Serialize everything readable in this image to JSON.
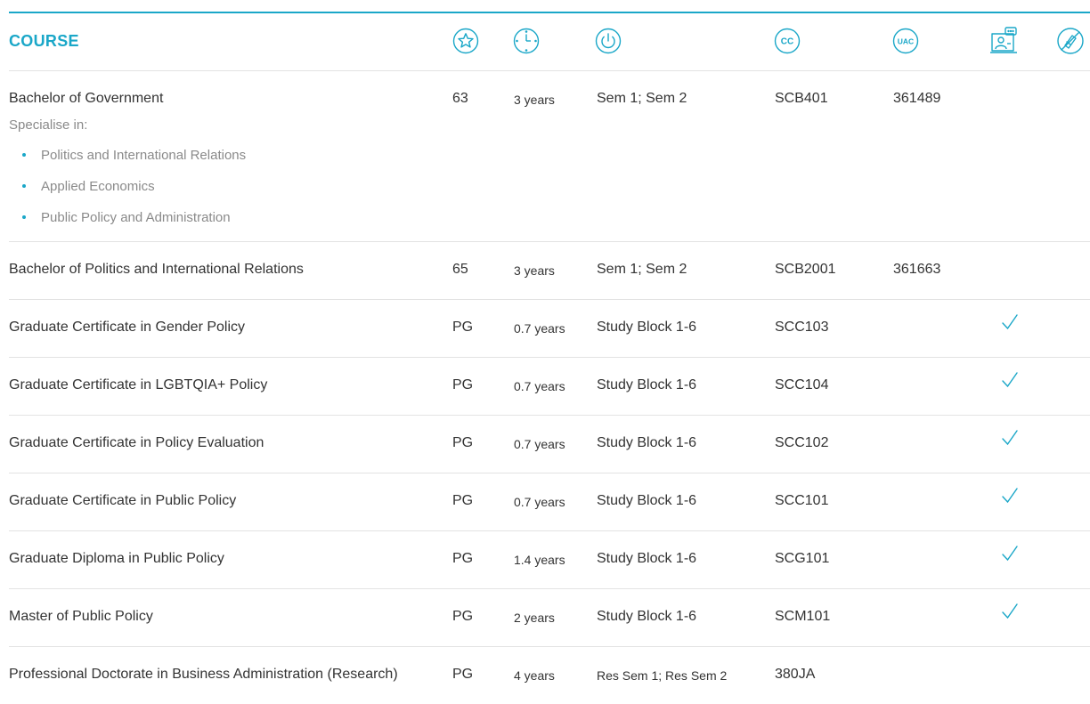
{
  "header": {
    "course_label": "COURSE",
    "icons": [
      "star-icon",
      "clock-icon",
      "power-icon",
      "cc-icon",
      "uac-icon",
      "online-icon",
      "no-campus-icon"
    ],
    "cc_text": "CC",
    "uac_text": "UAC"
  },
  "colors": {
    "accent": "#1aa7c8",
    "text": "#333333",
    "muted": "#8a8a8a",
    "divider": "#e3e3e3"
  },
  "rows": [
    {
      "title": "Bachelor of Government",
      "atar": "63",
      "duration": "3 years",
      "entry": "Sem 1; Sem 2",
      "cc": "SCB401",
      "uac": "361489",
      "online": false,
      "specialise_label": "Specialise in:",
      "specialisations": [
        "Politics and International Relations",
        "Applied Economics",
        "Public Policy and Administration"
      ]
    },
    {
      "title": "Bachelor of Politics and International Relations",
      "atar": "65",
      "duration": "3 years",
      "entry": "Sem 1; Sem 2",
      "cc": "SCB2001",
      "uac": "361663",
      "online": false
    },
    {
      "title": "Graduate Certificate in Gender Policy",
      "atar": "PG",
      "duration": "0.7 years",
      "entry": "Study Block 1-6",
      "cc": "SCC103",
      "uac": "",
      "online": true
    },
    {
      "title": "Graduate Certificate in LGBTQIA+ Policy",
      "atar": "PG",
      "duration": "0.7 years",
      "entry": "Study Block 1-6",
      "cc": "SCC104",
      "uac": "",
      "online": true
    },
    {
      "title": "Graduate Certificate in Policy Evaluation",
      "atar": "PG",
      "duration": "0.7 years",
      "entry": "Study Block 1-6",
      "cc": "SCC102",
      "uac": "",
      "online": true
    },
    {
      "title": "Graduate Certificate in Public Policy",
      "atar": "PG",
      "duration": "0.7 years",
      "entry": "Study Block 1-6",
      "cc": "SCC101",
      "uac": "",
      "online": true
    },
    {
      "title": "Graduate Diploma in Public Policy",
      "atar": "PG",
      "duration": "1.4 years",
      "entry": "Study Block 1-6",
      "cc": "SCG101",
      "uac": "",
      "online": true
    },
    {
      "title": "Master of Public Policy",
      "atar": "PG",
      "duration": "2 years",
      "entry": "Study Block 1-6",
      "cc": "SCM101",
      "uac": "",
      "online": true
    },
    {
      "title": "Professional Doctorate in Business Administration (Research)",
      "atar": "PG",
      "duration": "4 years",
      "entry": "Res Sem 1; Res Sem 2",
      "cc": "380JA",
      "uac": "",
      "online": false
    }
  ]
}
